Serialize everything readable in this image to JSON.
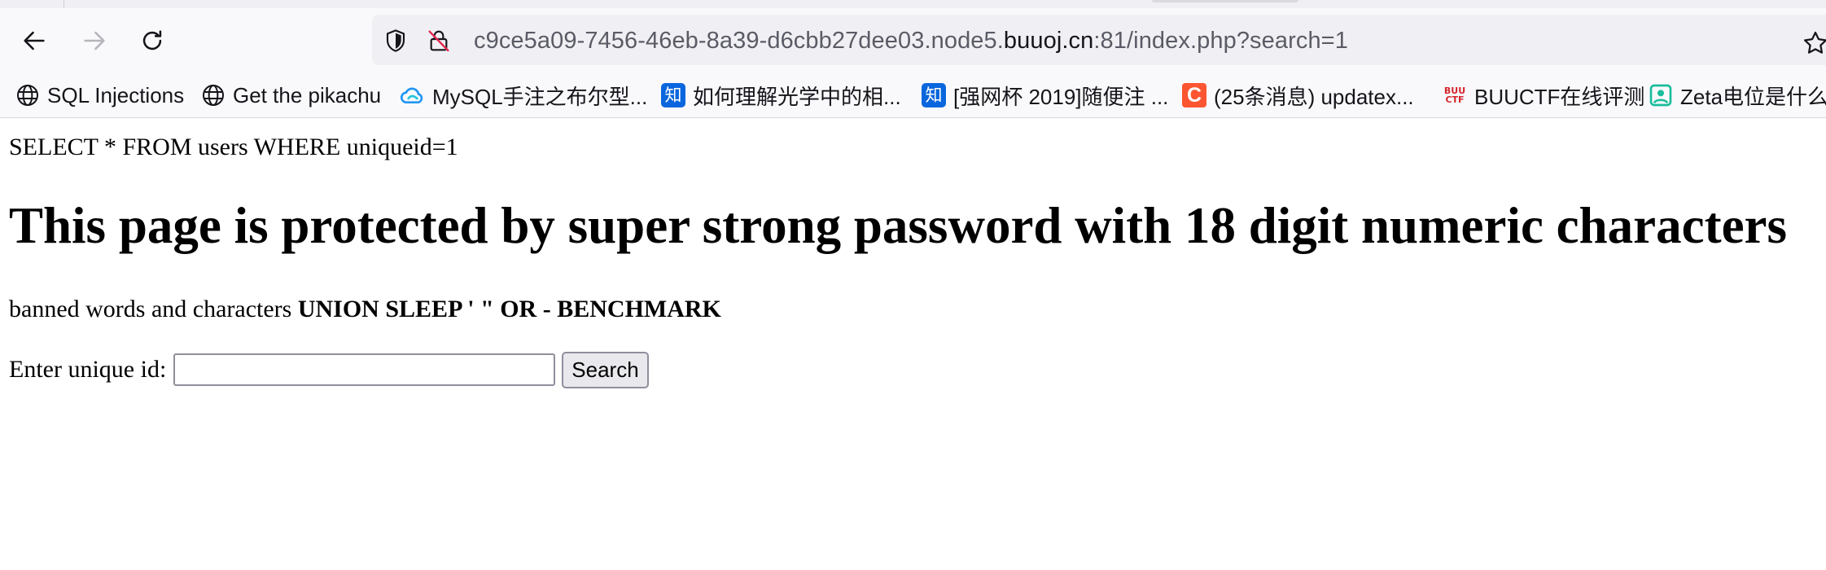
{
  "browser": {
    "url": {
      "prefix": "c9ce5a09-7456-46eb-8a39-d6cbb27dee03.node5.",
      "domain": "buuoj.cn",
      "suffix": ":81/index.php?search=1"
    },
    "bookmarks": [
      {
        "label": "SQL Injections",
        "icon": "globe-icon"
      },
      {
        "label": "Get the pikachu",
        "icon": "globe-icon"
      },
      {
        "label": "MySQL手注之布尔型...",
        "icon": "cloud-icon"
      },
      {
        "label": "如何理解光学中的相...",
        "icon": "zhihu-icon",
        "icon_text": "知"
      },
      {
        "label": "[强网杯 2019]随便注 ...",
        "icon": "zhihu-icon",
        "icon_text": "知"
      },
      {
        "label": "(25条消息) updatex...",
        "icon": "csdn-icon",
        "icon_text": "C"
      },
      {
        "label": "BUUCTF在线评测",
        "icon": "buuctf-icon"
      },
      {
        "label": "Zeta电位是什么?",
        "icon": "zeta-icon"
      }
    ],
    "colors": {
      "toolbar_bg": "#f9f9fb",
      "urlbar_bg": "#f0f0f4",
      "zhihu_blue": "#0a66dd",
      "csdn_orange": "#fc5531"
    }
  },
  "page": {
    "query": "SELECT * FROM users WHERE uniqueid=1",
    "heading": "This page is protected by super strong password with 18 digit numeric characters",
    "banned_label": "banned words and characters",
    "banned_words": "UNION SLEEP ' \" OR - BENCHMARK",
    "form": {
      "label": "Enter unique id:",
      "input_value": "",
      "button_label": "Search"
    }
  }
}
